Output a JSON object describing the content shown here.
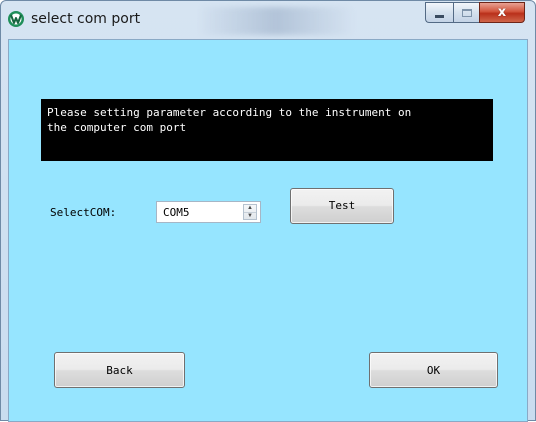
{
  "window": {
    "title": "select com port",
    "icon": "app-logo-icon",
    "caption_buttons": {
      "minimize_icon": "minimize-icon",
      "maximize_icon": "maximize-icon",
      "close_glyph": "x"
    }
  },
  "message": {
    "text": "Please setting parameter according to the instrument on\nthe computer com port"
  },
  "com_selector": {
    "label": "SelectCOM:",
    "value": "COM5",
    "up_glyph": "▲",
    "down_glyph": "▼"
  },
  "buttons": {
    "test": "Test",
    "back": "Back",
    "ok": "OK"
  },
  "colors": {
    "client_background": "#96e5ff",
    "message_background": "#000000",
    "message_text": "#ffffff",
    "close_button": "#c9452c"
  }
}
